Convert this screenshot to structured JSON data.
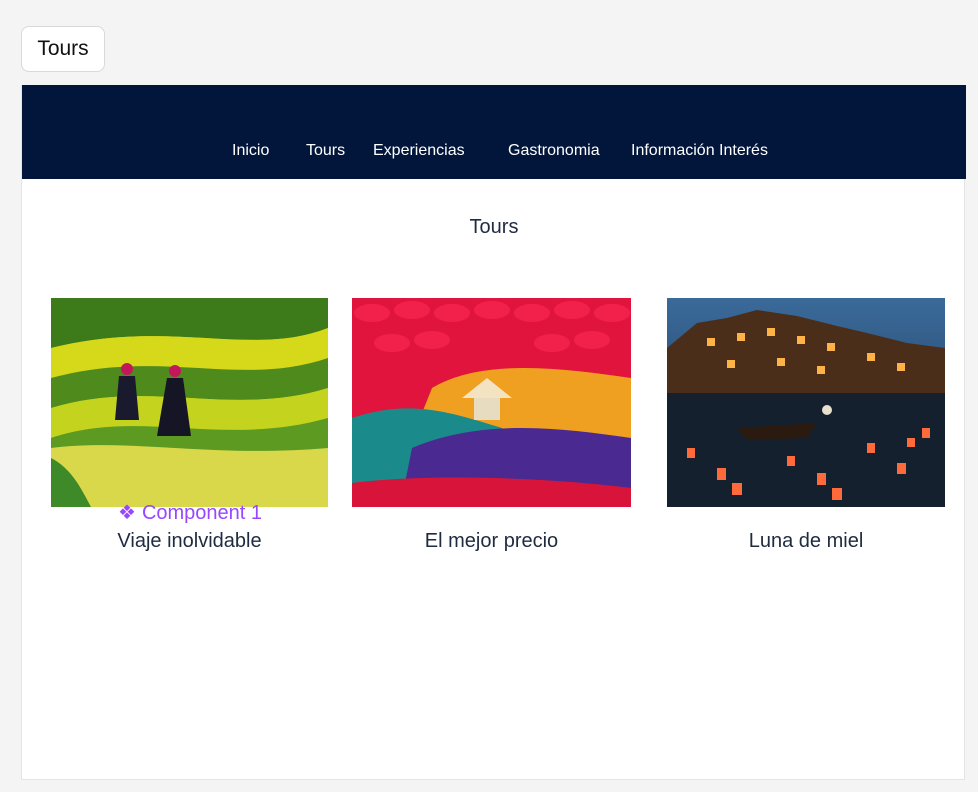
{
  "frame_tag": "Tours",
  "nav": {
    "items": [
      {
        "label": "Inicio"
      },
      {
        "label": "Tours"
      },
      {
        "label": "Experiencias"
      },
      {
        "label": "Gastronomia"
      },
      {
        "label": "Información Interés"
      }
    ]
  },
  "section_title": "Tours",
  "component_label": "Component 1",
  "component_icon": "component-diamond-icon",
  "cards": [
    {
      "caption": "Viaje inolvidable",
      "image": "rice-terraces-photo"
    },
    {
      "caption": "El mejor precio",
      "image": "incense-bundles-photo"
    },
    {
      "caption": "Luna de miel",
      "image": "lantern-river-night-photo"
    }
  ],
  "colors": {
    "navbar": "#02163b",
    "text": "#1f2b40",
    "component": "#9747ff"
  }
}
